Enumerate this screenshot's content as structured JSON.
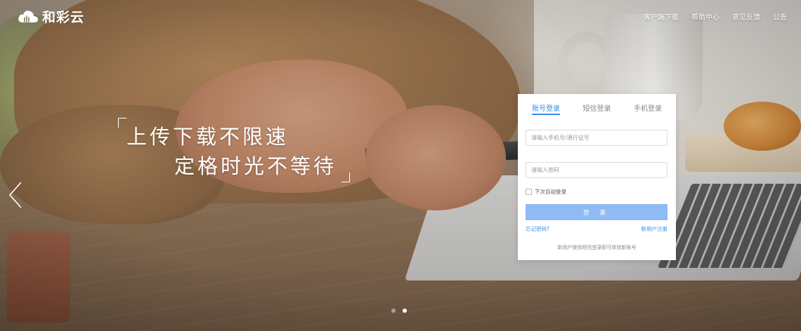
{
  "brand": {
    "name": "和彩云",
    "icon": "cloud-logo-icon"
  },
  "topnav": {
    "items": [
      {
        "label": "客户端下载"
      },
      {
        "label": "帮助中心"
      },
      {
        "label": "意见反馈"
      },
      {
        "label": "公告"
      }
    ]
  },
  "hero": {
    "line1": "上传下载不限速",
    "line2": "定格时光不等待"
  },
  "carousel": {
    "prev_icon": "chevron-left-icon",
    "slide_count": 2,
    "active_slide": 2
  },
  "login": {
    "tabs": [
      {
        "label": "账号登录",
        "active": true
      },
      {
        "label": "短信登录",
        "active": false
      },
      {
        "label": "手机登录",
        "active": false
      }
    ],
    "account_placeholder": "请输入手机号/通行证号",
    "password_placeholder": "请输入密码",
    "remember_label": "下次自动登录",
    "submit_label": "登 录",
    "forgot_label": "忘记密码?",
    "register_label": "新用户注册",
    "tip": "新用户使用短信登录即可体验新账号"
  },
  "colors": {
    "accent": "#3a8de6",
    "button": "#8fbaf5"
  }
}
